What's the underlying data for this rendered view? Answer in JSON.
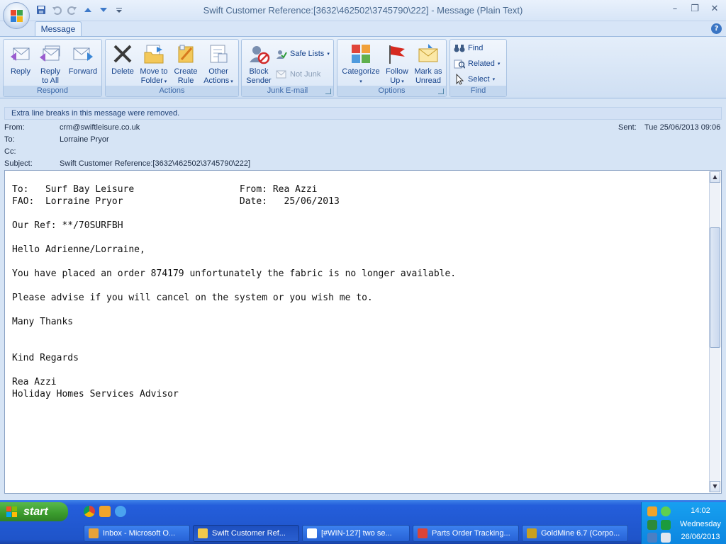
{
  "window": {
    "title": "Swift Customer Reference:[3632\\462502\\3745790\\222] - Message (Plain Text)",
    "controls": [
      "–",
      "❐",
      "✕"
    ]
  },
  "quick_access": [
    "save-icon",
    "undo-icon",
    "redo-icon",
    "previous-item-icon",
    "next-item-icon",
    "customize-icon"
  ],
  "tabs": {
    "message": "Message",
    "help": "?"
  },
  "ribbon": {
    "groups": {
      "respond": "Respond",
      "actions": "Actions",
      "junk": "Junk E-mail",
      "options": "Options",
      "find": "Find"
    },
    "respond": {
      "reply": "Reply",
      "reply_all": "Reply\nto All",
      "forward": "Forward"
    },
    "actions": {
      "delete": "Delete",
      "move_to_folder": "Move to\nFolder",
      "create_rule": "Create\nRule",
      "other_actions": "Other\nActions"
    },
    "junk": {
      "block_sender": "Block\nSender",
      "safe_lists": "Safe Lists",
      "not_junk": "Not Junk"
    },
    "options": {
      "categorize": "Categorize",
      "follow_up": "Follow\nUp",
      "mark_as_unread": "Mark as\nUnread"
    },
    "find": {
      "find": "Find",
      "related": "Related",
      "select": "Select"
    }
  },
  "infobar": "Extra line breaks in this message were removed.",
  "header": {
    "from_label": "From:",
    "from_value": "crm@swiftleisure.co.uk",
    "to_label": "To:",
    "to_value": "Lorraine Pryor",
    "cc_label": "Cc:",
    "cc_value": "",
    "subject_label": "Subject:",
    "subject_value": "Swift Customer Reference:[3632\\462502\\3745790\\222]",
    "sent_label": "Sent:",
    "sent_value": "Tue 25/06/2013 09:06"
  },
  "body_lines": [
    "To:   Surf Bay Leisure                   From: Rea Azzi",
    "FAO:  Lorraine Pryor                     Date:   25/06/2013",
    "",
    "Our Ref: **/70SURFBH",
    "",
    "Hello Adrienne/Lorraine,",
    "",
    "You have placed an order 874179 unfortunately the fabric is no longer available.",
    "",
    "Please advise if you will cancel on the system or you wish me to.",
    "",
    "Many Thanks",
    "",
    "",
    "Kind Regards",
    "",
    "Rea Azzi",
    "Holiday Homes Services Advisor"
  ],
  "scrollbar": {
    "up": "▲",
    "down": "▼",
    "thumb_position": 0.25
  },
  "taskbar": {
    "start": "start",
    "buttons": [
      {
        "label": "Inbox - Microsoft O...",
        "icon": "outlook-icon",
        "color": "#e8a33a"
      },
      {
        "label": "Swift Customer Ref...",
        "icon": "message-icon",
        "color": "#f2c94c"
      },
      {
        "label": "[#WIN-127] two se...",
        "icon": "jira-icon",
        "color": "#ffffff"
      },
      {
        "label": "Parts Order Tracking...",
        "icon": "chrome-icon",
        "color": "#db4437"
      },
      {
        "label": "GoldMine 6.7 (Corpo...",
        "icon": "goldmine-icon",
        "color": "#c8a020"
      }
    ],
    "quicklaunch": [
      "chrome-icon",
      "outlook-icon",
      "ie-icon"
    ],
    "clock": {
      "time": "14:02",
      "day": "Wednesday",
      "date": "26/06/2013"
    }
  }
}
